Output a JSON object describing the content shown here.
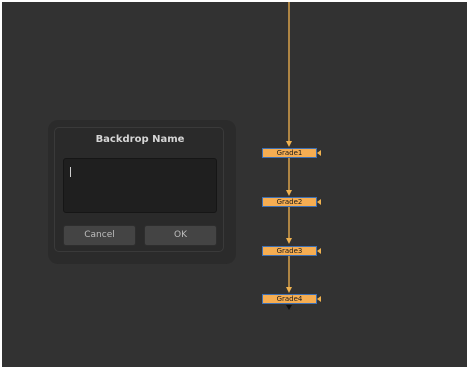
{
  "canvas": {
    "background": "#323232",
    "edge_color": "#f0b24f",
    "node_color": "#f5ad52",
    "node_border": "#3d6fb3"
  },
  "nodes": [
    {
      "label": "Grade1"
    },
    {
      "label": "Grade2"
    },
    {
      "label": "Grade3"
    },
    {
      "label": "Grade4"
    }
  ],
  "dialog": {
    "title": "Backdrop Name",
    "input_value": "",
    "cancel_label": "Cancel",
    "ok_label": "OK"
  }
}
